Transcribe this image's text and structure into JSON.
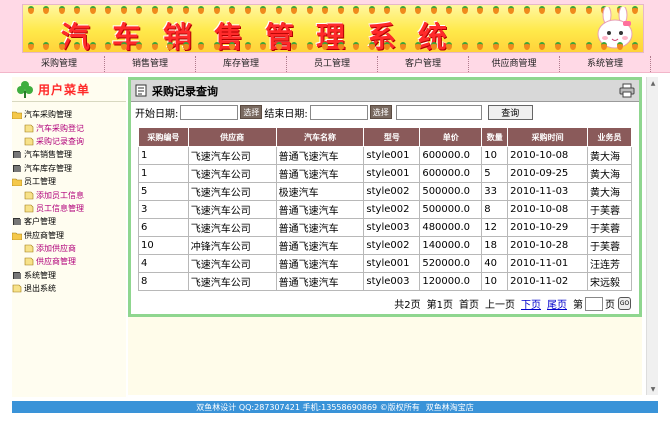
{
  "app": {
    "title": "汽车销售管理系统"
  },
  "nav": [
    "采购管理",
    "销售管理",
    "库存管理",
    "员工管理",
    "客户管理",
    "供应商管理",
    "系统管理"
  ],
  "sidebar": {
    "title": "用户菜单",
    "items": [
      {
        "label": "汽车采购管理",
        "level": 0,
        "icon": "folder-open-icon"
      },
      {
        "label": "汽车采购登记",
        "level": 1,
        "icon": "document-icon"
      },
      {
        "label": "采购记录查询",
        "level": 1,
        "icon": "document-icon"
      },
      {
        "label": "汽车销售管理",
        "level": 0,
        "icon": "book-icon"
      },
      {
        "label": "汽车库存管理",
        "level": 0,
        "icon": "book-icon"
      },
      {
        "label": "员工管理",
        "level": 0,
        "icon": "folder-open-icon"
      },
      {
        "label": "添加员工信息",
        "level": 1,
        "icon": "document-icon"
      },
      {
        "label": "员工信息管理",
        "level": 1,
        "icon": "document-icon"
      },
      {
        "label": "客户管理",
        "level": 0,
        "icon": "book-icon"
      },
      {
        "label": "供应商管理",
        "level": 0,
        "icon": "folder-open-icon"
      },
      {
        "label": "添加供应商",
        "level": 1,
        "icon": "document-icon"
      },
      {
        "label": "供应商管理",
        "level": 1,
        "icon": "document-icon"
      },
      {
        "label": "系统管理",
        "level": 0,
        "icon": "book-icon"
      },
      {
        "label": "退出系统",
        "level": 0,
        "icon": "document-icon"
      }
    ]
  },
  "panel": {
    "title": "采购记录查询"
  },
  "search": {
    "start_label": "开始日期:",
    "end_label": "结束日期:",
    "pick_label": "选择",
    "query_label": "查询"
  },
  "table": {
    "headers": [
      "采购编号",
      "供应商",
      "汽车名称",
      "型号",
      "单价",
      "数量",
      "采购时间",
      "业务员"
    ],
    "rows": [
      [
        "1",
        "飞速汽车公司",
        "普通飞速汽车",
        "style001",
        "600000.0",
        "10",
        "2010-10-08",
        "黄大海"
      ],
      [
        "1",
        "飞速汽车公司",
        "普通飞速汽车",
        "style001",
        "600000.0",
        "5",
        "2010-09-25",
        "黄大海"
      ],
      [
        "5",
        "飞速汽车公司",
        "极速汽车",
        "style002",
        "500000.0",
        "33",
        "2010-11-03",
        "黄大海"
      ],
      [
        "3",
        "飞速汽车公司",
        "普通飞速汽车",
        "style002",
        "500000.0",
        "8",
        "2010-10-08",
        "于芙蓉"
      ],
      [
        "6",
        "飞速汽车公司",
        "普通飞速汽车",
        "style003",
        "480000.0",
        "12",
        "2010-10-29",
        "于芙蓉"
      ],
      [
        "10",
        "冲锋汽车公司",
        "普通飞速汽车",
        "style002",
        "140000.0",
        "18",
        "2010-10-28",
        "于芙蓉"
      ],
      [
        "4",
        "飞速汽车公司",
        "普通飞速汽车",
        "style001",
        "520000.0",
        "40",
        "2010-11-01",
        "汪连芳"
      ],
      [
        "8",
        "飞速汽车公司",
        "普通飞速汽车",
        "style003",
        "120000.0",
        "10",
        "2010-11-02",
        "宋远毅"
      ]
    ]
  },
  "pager": {
    "total": "共2页",
    "current": "第1页",
    "first": "首页",
    "prev": "上一页",
    "next": "下页",
    "last": "尾页",
    "goto_prefix": "第",
    "goto_suffix": "页",
    "go": "GO"
  },
  "footer": {
    "text": "双鱼林设计 QQ:287307421 手机:13558690869 ©版权所有",
    "link": "双鱼林淘宝店"
  }
}
